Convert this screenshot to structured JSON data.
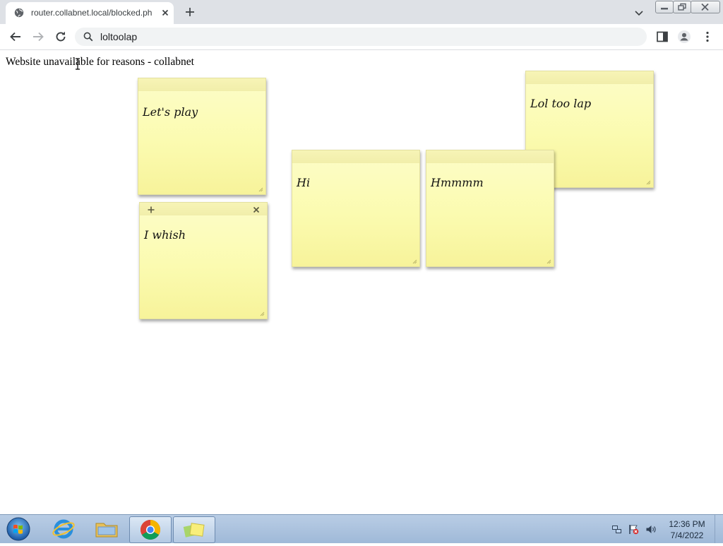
{
  "browser": {
    "tab_title": "router.collabnet.local/blocked.ph",
    "address": "loltoolap"
  },
  "page": {
    "message": "Website unavailable for reasons - collabnet"
  },
  "notes": [
    {
      "text": "Let's play"
    },
    {
      "text": "I whish"
    },
    {
      "text": "Hi"
    },
    {
      "text": "Hmmmm"
    },
    {
      "text": "Lol too lap"
    }
  ],
  "taskbar": {
    "time": "12:36 PM",
    "date": "7/4/2022"
  },
  "colors": {
    "note_yellow": "#fbfbb0",
    "chrome_tabbar": "#dee1e6",
    "taskbar_blue": "#a9c2de"
  }
}
